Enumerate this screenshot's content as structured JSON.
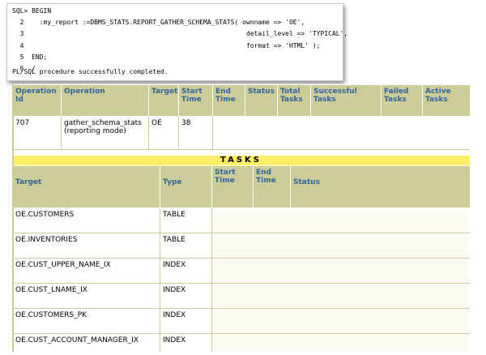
{
  "console": {
    "lines": [
      "SQL> BEGIN",
      "  2    :my_report :=DBMS_STATS.REPORT_GATHER_SCHEMA_STATS( ownname => 'OE',",
      "  3                                                         detail_level => 'TYPICAL',",
      "  4                                                         format => 'HTML' );",
      "  5  END;",
      "  6  /"
    ],
    "completed_message": "PL/SQL procedure successfully completed."
  },
  "operations_table": {
    "headers": [
      "Operation Id",
      "Operation",
      "Target",
      "Start Time",
      "End Time",
      "Status",
      "Total Tasks",
      "Successful Tasks",
      "Failed Tasks",
      "Active Tasks"
    ],
    "row": {
      "operation_id": "707",
      "operation": "gather_schema_stats (reporting mode)",
      "target": "OE",
      "start_time": "38",
      "end_time": "",
      "status": "",
      "total_tasks": "",
      "successful_tasks": "",
      "failed_tasks": "",
      "active_tasks": ""
    }
  },
  "tasks": {
    "banner": "TASKS",
    "headers": [
      "Target",
      "Type",
      "Start Time",
      "End Time",
      "Status"
    ],
    "rows": [
      {
        "target": "OE.CUSTOMERS",
        "type": "TABLE"
      },
      {
        "target": "OE.INVENTORIES",
        "type": "TABLE"
      },
      {
        "target": "OE.CUST_UPPER_NAME_IX",
        "type": "INDEX"
      },
      {
        "target": "OE.CUST_LNAME_IX",
        "type": "INDEX"
      },
      {
        "target": "OE.CUSTOMERS_PK",
        "type": "INDEX"
      },
      {
        "target": "OE.CUST_ACCOUNT_MANAGER_IX",
        "type": "INDEX"
      }
    ]
  },
  "colors": {
    "header_bg": "#cccc99",
    "header_text": "#336699",
    "banner_bg": "#ffee66"
  }
}
